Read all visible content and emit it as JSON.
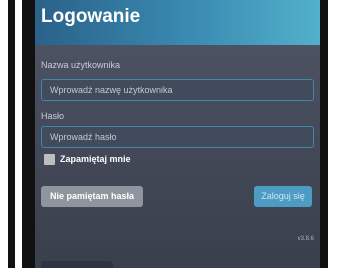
{
  "title": "Logowanie",
  "username": {
    "label": "Nazwa użytkownika",
    "placeholder": "Wprowadź nazwę użytkownika",
    "value": ""
  },
  "password": {
    "label": "Hasło",
    "placeholder": "Wprowadź hasło",
    "value": ""
  },
  "remember": {
    "label": "Zapamiętaj mnie",
    "checked": false
  },
  "buttons": {
    "forgot_label": "Nie pamiętam hasła",
    "login_label": "Zaloguj się"
  },
  "version": "v3.8.6",
  "colors": {
    "header_gradient_start": "#2a6189",
    "header_gradient_end": "#52b0cb",
    "panel_bg": "#454b5a",
    "field_border": "#3e87ad",
    "login_button": "#4c9cc4",
    "forgot_button": "#8f959e"
  }
}
